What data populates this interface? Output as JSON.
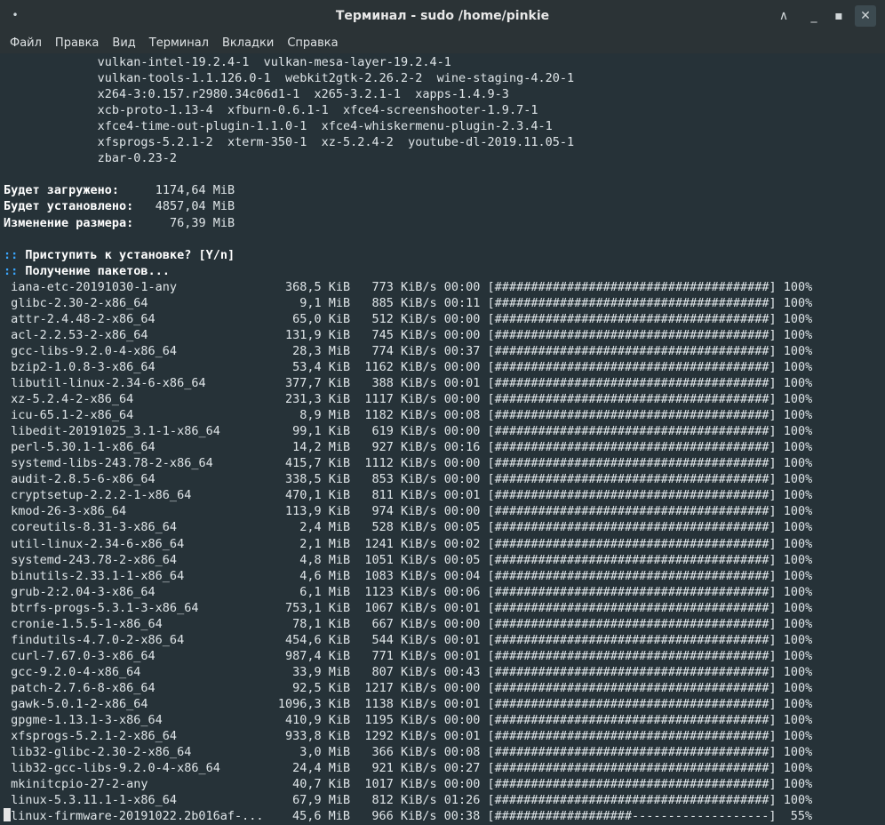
{
  "window": {
    "title": "Терминал - sudo /home/pinkie"
  },
  "titlebar_icons": {
    "menu": "•",
    "minimize": "∧",
    "maximize": "□",
    "restore": "▪",
    "close": "✕"
  },
  "menu": [
    "Файл",
    "Правка",
    "Вид",
    "Терминал",
    "Вкладки",
    "Справка"
  ],
  "packages_text": [
    "             vulkan-intel-19.2.4-1  vulkan-mesa-layer-19.2.4-1",
    "             vulkan-tools-1.1.126.0-1  webkit2gtk-2.26.2-2  wine-staging-4.20-1",
    "             x264-3:0.157.r2980.34c06d1-1  x265-3.2.1-1  xapps-1.4.9-3",
    "             xcb-proto-1.13-4  xfburn-0.6.1-1  xfce4-screenshooter-1.9.7-1",
    "             xfce4-time-out-plugin-1.1.0-1  xfce4-whiskermenu-plugin-2.3.4-1",
    "             xfsprogs-5.2.1-2  xterm-350-1  xz-5.2.4-2  youtube-dl-2019.11.05-1",
    "             zbar-0.23-2"
  ],
  "summary": [
    {
      "label": "Будет загружено:",
      "value": "  1174,64 MiB"
    },
    {
      "label": "Будет установлено:",
      "value": "  4857,04 MiB"
    },
    {
      "label": "Изменение размера:",
      "value": "    76,39 MiB"
    }
  ],
  "prompts": [
    {
      "marker": "::",
      "text": " Приступить к установке? [Y/n]"
    },
    {
      "marker": "::",
      "text": " Получение пакетов..."
    }
  ],
  "downloads": [
    {
      "name": " iana-etc-20191030-1-any",
      "size": "368,5 KiB",
      "speed": " 773 KiB/s",
      "time": "00:00",
      "bar": "[######################################]",
      "pct": "100%"
    },
    {
      "name": " glibc-2.30-2-x86_64",
      "size": "9,1 MiB",
      "speed": " 885 KiB/s",
      "time": "00:11",
      "bar": "[######################################]",
      "pct": "100%"
    },
    {
      "name": " attr-2.4.48-2-x86_64",
      "size": "65,0 KiB",
      "speed": " 512 KiB/s",
      "time": "00:00",
      "bar": "[######################################]",
      "pct": "100%"
    },
    {
      "name": " acl-2.2.53-2-x86_64",
      "size": "131,9 KiB",
      "speed": " 745 KiB/s",
      "time": "00:00",
      "bar": "[######################################]",
      "pct": "100%"
    },
    {
      "name": " gcc-libs-9.2.0-4-x86_64",
      "size": "28,3 MiB",
      "speed": " 774 KiB/s",
      "time": "00:37",
      "bar": "[######################################]",
      "pct": "100%"
    },
    {
      "name": " bzip2-1.0.8-3-x86_64",
      "size": "53,4 KiB",
      "speed": "1162 KiB/s",
      "time": "00:00",
      "bar": "[######################################]",
      "pct": "100%"
    },
    {
      "name": " libutil-linux-2.34-6-x86_64",
      "size": "377,7 KiB",
      "speed": " 388 KiB/s",
      "time": "00:01",
      "bar": "[######################################]",
      "pct": "100%"
    },
    {
      "name": " xz-5.2.4-2-x86_64",
      "size": "231,3 KiB",
      "speed": "1117 KiB/s",
      "time": "00:00",
      "bar": "[######################################]",
      "pct": "100%"
    },
    {
      "name": " icu-65.1-2-x86_64",
      "size": "8,9 MiB",
      "speed": "1182 KiB/s",
      "time": "00:08",
      "bar": "[######################################]",
      "pct": "100%"
    },
    {
      "name": " libedit-20191025_3.1-1-x86_64",
      "size": "99,1 KiB",
      "speed": " 619 KiB/s",
      "time": "00:00",
      "bar": "[######################################]",
      "pct": "100%"
    },
    {
      "name": " perl-5.30.1-1-x86_64",
      "size": "14,2 MiB",
      "speed": " 927 KiB/s",
      "time": "00:16",
      "bar": "[######################################]",
      "pct": "100%"
    },
    {
      "name": " systemd-libs-243.78-2-x86_64",
      "size": "415,7 KiB",
      "speed": "1112 KiB/s",
      "time": "00:00",
      "bar": "[######################################]",
      "pct": "100%"
    },
    {
      "name": " audit-2.8.5-6-x86_64",
      "size": "338,5 KiB",
      "speed": " 853 KiB/s",
      "time": "00:00",
      "bar": "[######################################]",
      "pct": "100%"
    },
    {
      "name": " cryptsetup-2.2.2-1-x86_64",
      "size": "470,1 KiB",
      "speed": " 811 KiB/s",
      "time": "00:01",
      "bar": "[######################################]",
      "pct": "100%"
    },
    {
      "name": " kmod-26-3-x86_64",
      "size": "113,9 KiB",
      "speed": " 974 KiB/s",
      "time": "00:00",
      "bar": "[######################################]",
      "pct": "100%"
    },
    {
      "name": " coreutils-8.31-3-x86_64",
      "size": "2,4 MiB",
      "speed": " 528 KiB/s",
      "time": "00:05",
      "bar": "[######################################]",
      "pct": "100%"
    },
    {
      "name": " util-linux-2.34-6-x86_64",
      "size": "2,1 MiB",
      "speed": "1241 KiB/s",
      "time": "00:02",
      "bar": "[######################################]",
      "pct": "100%"
    },
    {
      "name": " systemd-243.78-2-x86_64",
      "size": "4,8 MiB",
      "speed": "1051 KiB/s",
      "time": "00:05",
      "bar": "[######################################]",
      "pct": "100%"
    },
    {
      "name": " binutils-2.33.1-1-x86_64",
      "size": "4,6 MiB",
      "speed": "1083 KiB/s",
      "time": "00:04",
      "bar": "[######################################]",
      "pct": "100%"
    },
    {
      "name": " grub-2:2.04-3-x86_64",
      "size": "6,1 MiB",
      "speed": "1123 KiB/s",
      "time": "00:06",
      "bar": "[######################################]",
      "pct": "100%"
    },
    {
      "name": " btrfs-progs-5.3.1-3-x86_64",
      "size": "753,1 KiB",
      "speed": "1067 KiB/s",
      "time": "00:01",
      "bar": "[######################################]",
      "pct": "100%"
    },
    {
      "name": " cronie-1.5.5-1-x86_64",
      "size": "78,1 KiB",
      "speed": " 667 KiB/s",
      "time": "00:00",
      "bar": "[######################################]",
      "pct": "100%"
    },
    {
      "name": " findutils-4.7.0-2-x86_64",
      "size": "454,6 KiB",
      "speed": " 544 KiB/s",
      "time": "00:01",
      "bar": "[######################################]",
      "pct": "100%"
    },
    {
      "name": " curl-7.67.0-3-x86_64",
      "size": "987,4 KiB",
      "speed": " 771 KiB/s",
      "time": "00:01",
      "bar": "[######################################]",
      "pct": "100%"
    },
    {
      "name": " gcc-9.2.0-4-x86_64",
      "size": "33,9 MiB",
      "speed": " 807 KiB/s",
      "time": "00:43",
      "bar": "[######################################]",
      "pct": "100%"
    },
    {
      "name": " patch-2.7.6-8-x86_64",
      "size": "92,5 KiB",
      "speed": "1217 KiB/s",
      "time": "00:00",
      "bar": "[######################################]",
      "pct": "100%"
    },
    {
      "name": " gawk-5.0.1-2-x86_64",
      "size": "1096,3 KiB",
      "speed": "1138 KiB/s",
      "time": "00:01",
      "bar": "[######################################]",
      "pct": "100%"
    },
    {
      "name": " gpgme-1.13.1-3-x86_64",
      "size": "410,9 KiB",
      "speed": "1195 KiB/s",
      "time": "00:00",
      "bar": "[######################################]",
      "pct": "100%"
    },
    {
      "name": " xfsprogs-5.2.1-2-x86_64",
      "size": "933,8 KiB",
      "speed": "1292 KiB/s",
      "time": "00:01",
      "bar": "[######################################]",
      "pct": "100%"
    },
    {
      "name": " lib32-glibc-2.30-2-x86_64",
      "size": "3,0 MiB",
      "speed": " 366 KiB/s",
      "time": "00:08",
      "bar": "[######################################]",
      "pct": "100%"
    },
    {
      "name": " lib32-gcc-libs-9.2.0-4-x86_64",
      "size": "24,4 MiB",
      "speed": " 921 KiB/s",
      "time": "00:27",
      "bar": "[######################################]",
      "pct": "100%"
    },
    {
      "name": " mkinitcpio-27-2-any",
      "size": "40,7 KiB",
      "speed": "1017 KiB/s",
      "time": "00:00",
      "bar": "[######################################]",
      "pct": "100%"
    },
    {
      "name": " linux-5.3.11.1-1-x86_64",
      "size": "67,9 MiB",
      "speed": " 812 KiB/s",
      "time": "01:26",
      "bar": "[######################################]",
      "pct": "100%"
    },
    {
      "name": "linux-firmware-20191022.2b016af-...",
      "size": "45,6 MiB",
      "speed": " 966 KiB/s",
      "time": "00:38",
      "bar": "[###################-------------------]",
      "pct": " 55%"
    }
  ]
}
